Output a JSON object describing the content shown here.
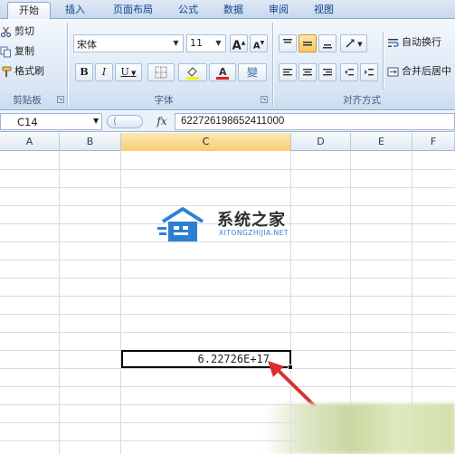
{
  "tabs": [
    {
      "label": "开始",
      "active": true
    },
    {
      "label": "插入"
    },
    {
      "label": "页面布局"
    },
    {
      "label": "公式"
    },
    {
      "label": "数据"
    },
    {
      "label": "审阅"
    },
    {
      "label": "视图"
    }
  ],
  "clipboard": {
    "cut": "剪切",
    "copy": "复制",
    "format_painter": "格式刷",
    "group_label": "剪贴板"
  },
  "font": {
    "name": "宋体",
    "size": "11",
    "bold": "B",
    "italic": "I",
    "underline": "U",
    "grow": "A",
    "shrink": "A",
    "group_label": "字体",
    "phonetic": "變"
  },
  "alignment": {
    "wrap_text": "自动换行",
    "merge_center": "合并后居中",
    "group_label": "对齐方式"
  },
  "formula_bar": {
    "name_box": "C14",
    "fx": "fx",
    "content": "622726198652411000"
  },
  "columns": [
    "A",
    "B",
    "C",
    "D",
    "E",
    "F"
  ],
  "selected_column": "C",
  "active_cell": {
    "ref": "C14",
    "display": "6.22726E+17"
  },
  "watermark": {
    "title": "系统之家",
    "subtitle": "XITONGZHIJIA.NET"
  },
  "colors": {
    "ribbon_bg": "#dae6f4",
    "selection": "#f8cd72",
    "annotation_arrow": "#d9302c",
    "watermark_blue": "#2d7fd6"
  }
}
